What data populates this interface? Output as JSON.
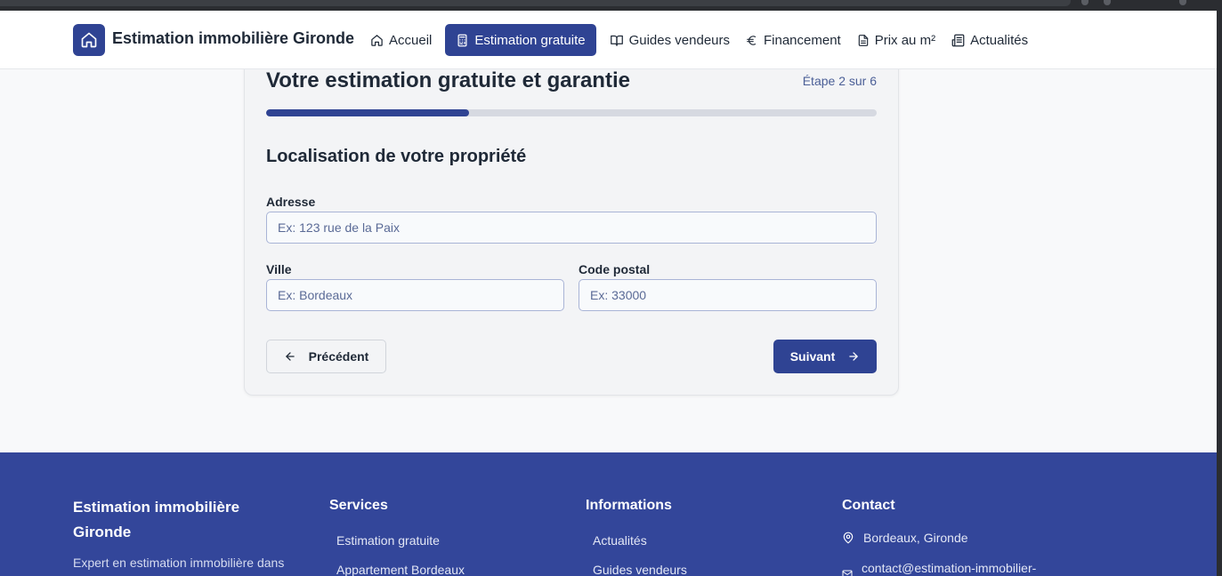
{
  "header": {
    "brand": "Estimation immobilière Gironde",
    "nav": [
      {
        "label": "Accueil",
        "icon": "home-icon"
      },
      {
        "label": "Estimation gratuite",
        "icon": "calculator-icon"
      },
      {
        "label": "Guides vendeurs",
        "icon": "book-icon"
      },
      {
        "label": "Financement",
        "icon": "euro-icon"
      },
      {
        "label": "Prix au m²",
        "icon": "document-icon"
      },
      {
        "label": "Actualités",
        "icon": "newspaper-icon"
      }
    ]
  },
  "form": {
    "title": "Votre estimation gratuite et garantie",
    "step_text": "Étape 2 sur 6",
    "progress_fraction": 0.333,
    "section_title": "Localisation de votre propriété",
    "address": {
      "label": "Adresse",
      "placeholder": "Ex: 123 rue de la Paix",
      "value": ""
    },
    "city": {
      "label": "Ville",
      "placeholder": "Ex: Bordeaux",
      "value": ""
    },
    "postal_code": {
      "label": "Code postal",
      "placeholder": "Ex: 33000",
      "value": ""
    },
    "prev_label": "Précédent",
    "next_label": "Suivant"
  },
  "footer": {
    "brand": "Estimation immobilière Gironde",
    "description": "Expert en estimation immobilière dans",
    "services": {
      "heading": "Services",
      "links": [
        "Estimation gratuite",
        "Appartement Bordeaux"
      ]
    },
    "informations": {
      "heading": "Informations",
      "links": [
        "Actualités",
        "Guides vendeurs"
      ]
    },
    "contact": {
      "heading": "Contact",
      "location": "Bordeaux, Gironde",
      "email": "contact@estimation-immobilier-"
    }
  },
  "colors": {
    "primary": "#2f4393",
    "footer_bg": "#33469a",
    "page_bg": "#f8f9fa"
  }
}
